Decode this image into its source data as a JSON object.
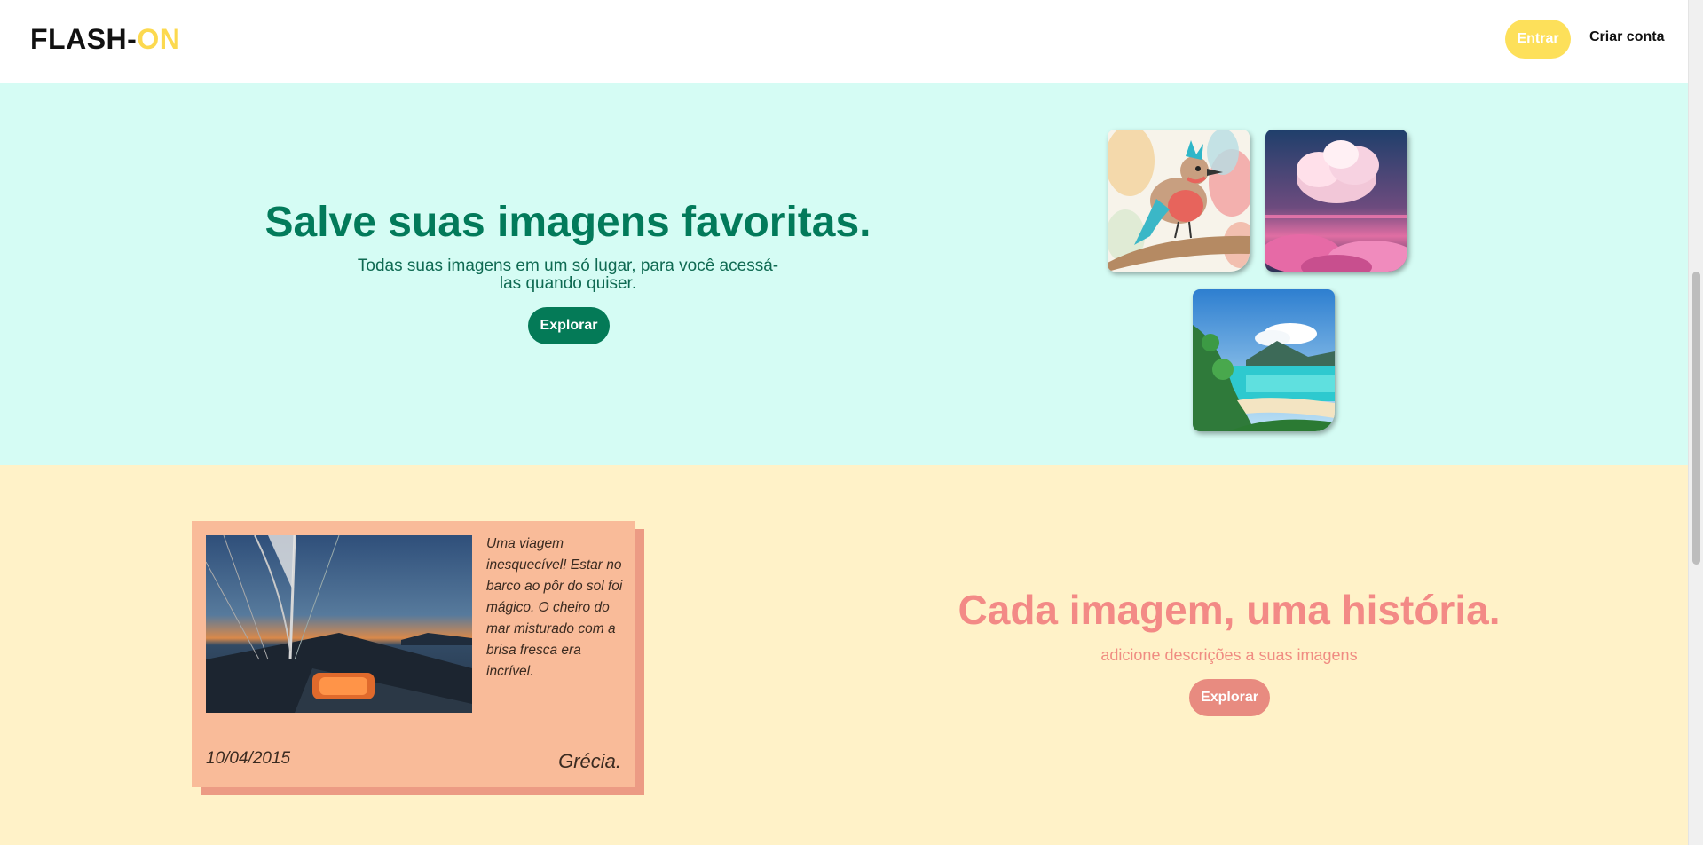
{
  "header": {
    "logo_main": "FLASH-",
    "logo_accent": "ON",
    "login_label": "Entrar",
    "signup_label": "Criar conta"
  },
  "hero": {
    "title": "Salve suas imagens favoritas.",
    "subtitle": "Todas suas imagens em um só lugar, para você acessá-las quando quiser.",
    "button_label": "Explorar"
  },
  "story_card": {
    "description": "Uma viagem inesquecível! Estar no barco ao pôr do sol foi mágico. O cheiro do mar misturado com a brisa fresca era incrível.",
    "date": "10/04/2015",
    "place": "Grécia."
  },
  "story": {
    "title": "Cada imagem, uma história.",
    "subtitle": "adicione descrições a suas imagens",
    "button_label": "Explorar"
  },
  "colors": {
    "brand_yellow": "#fde05a",
    "brand_green": "#047a57",
    "mint_bg": "#d5fcf4",
    "cream_bg": "#fff2c8",
    "coral": "#f38a86",
    "card_bg": "#f9bb99"
  }
}
